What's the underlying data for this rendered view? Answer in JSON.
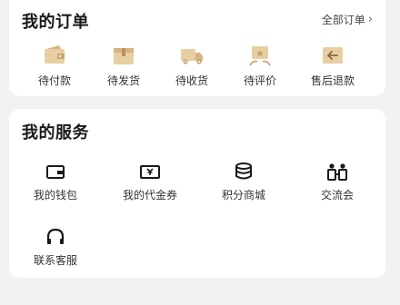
{
  "orders": {
    "title": "我的订单",
    "all_orders_label": "全部订单",
    "all_orders_chevron": "›",
    "items": [
      {
        "label": "待付款",
        "icon": "wallet-icon"
      },
      {
        "label": "待发货",
        "icon": "package-icon"
      },
      {
        "label": "待收货",
        "icon": "truck-icon"
      },
      {
        "label": "待评价",
        "icon": "review-icon"
      },
      {
        "label": "售后退款",
        "icon": "refund-icon"
      }
    ]
  },
  "services": {
    "title": "我的服务",
    "items": [
      {
        "label": "我的钱包",
        "icon": "wallet-outline-icon"
      },
      {
        "label": "我的代金券",
        "icon": "voucher-icon"
      },
      {
        "label": "积分商城",
        "icon": "coin-stack-icon"
      },
      {
        "label": "交流会",
        "icon": "people-icon"
      },
      {
        "label": "联系客服",
        "icon": "headset-icon"
      }
    ]
  },
  "colors": {
    "icon_tan": "#e7cfa3",
    "icon_brown": "#c9a36a",
    "icon_dark": "#1a1a1a",
    "background": "#f2f2f2",
    "card": "#ffffff"
  }
}
